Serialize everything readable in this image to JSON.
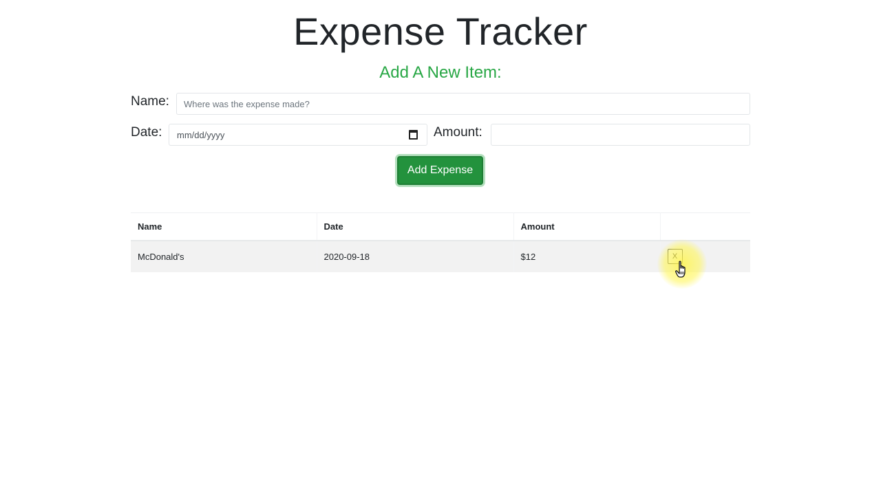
{
  "app": {
    "title": "Expense Tracker"
  },
  "form": {
    "heading": "Add A New Item:",
    "name_label": "Name:",
    "name_placeholder": "Where was the expense made?",
    "name_value": "",
    "date_label": "Date:",
    "date_placeholder": "mm/dd/yyyy",
    "amount_label": "Amount:",
    "amount_value": "",
    "submit_label": "Add Expense",
    "submit_color": "#23923d"
  },
  "table": {
    "headers": [
      "Name",
      "Date",
      "Amount",
      ""
    ],
    "rows": [
      {
        "name": "McDonald's",
        "date": "2020-09-18",
        "amount": "$12",
        "delete_label": "X"
      }
    ]
  },
  "colors": {
    "heading_green": "#28a745",
    "row_background": "#f2f2f2"
  },
  "icons": {
    "date_picker": "calendar-icon",
    "cursor": "hand-pointer-icon"
  }
}
